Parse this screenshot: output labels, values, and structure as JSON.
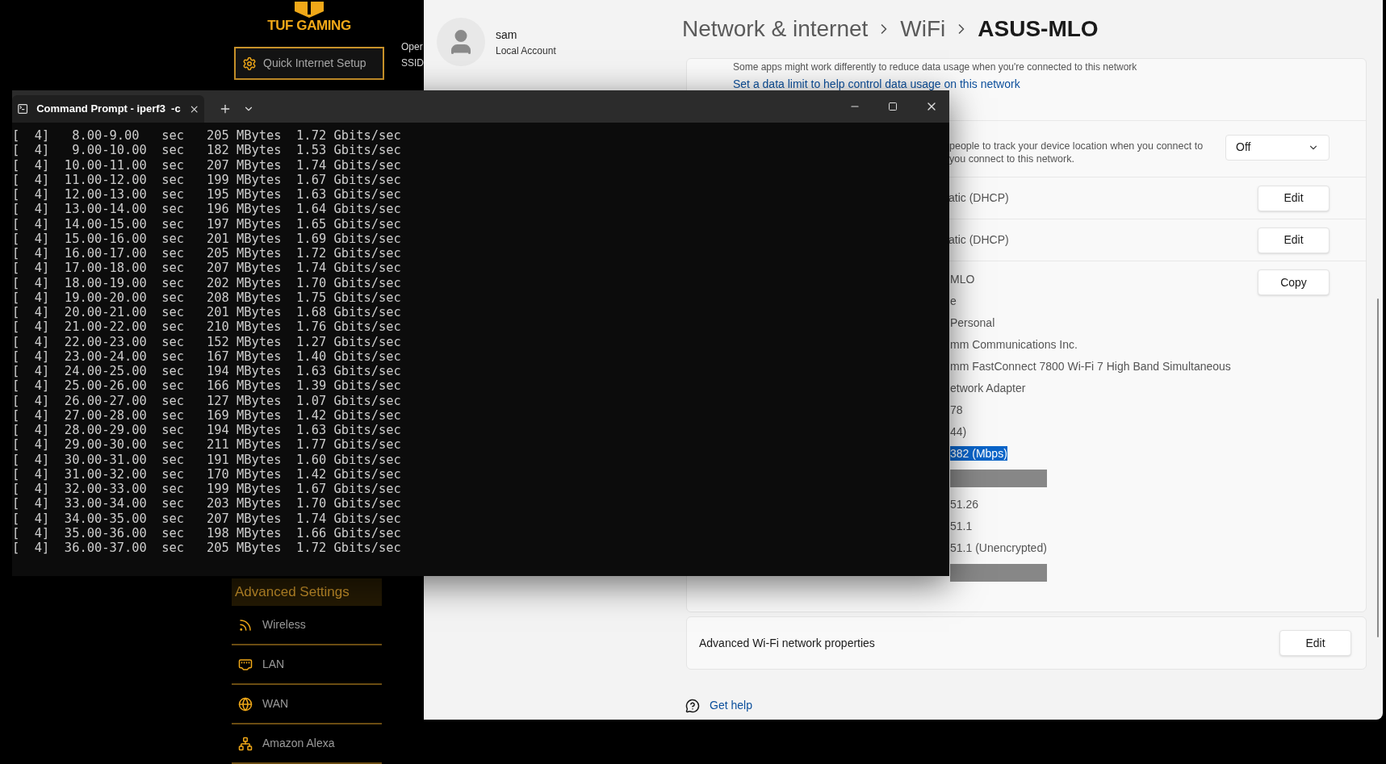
{
  "router": {
    "logo": "TUF GAMING",
    "quick_setup": "Quick Internet Setup",
    "status_labels": [
      "Oper",
      "SSID"
    ],
    "section_title": "Advanced Settings",
    "menu": [
      {
        "label": "Wireless",
        "kind": "wireless"
      },
      {
        "label": "LAN",
        "kind": "lan"
      },
      {
        "label": "WAN",
        "kind": "wan"
      },
      {
        "label": "Amazon Alexa",
        "kind": "alexa"
      }
    ]
  },
  "settings": {
    "user": {
      "name": "sam",
      "account_type": "Local Account"
    },
    "breadcrumb": [
      "Network & internet",
      "WiFi",
      "ASUS-MLO"
    ],
    "metered_note": "Some apps might work differently to reduce data usage when you're connected to this network",
    "data_limit_link": "Set a data limit to help control data usage on this network",
    "location": {
      "description": [
        "people to track your device location when you connect to",
        "you connect to this network."
      ],
      "dropdown": "Off"
    },
    "rows": [
      {
        "value": "atic (DHCP)",
        "button": "Edit"
      },
      {
        "value": "atic (DHCP)",
        "button": "Edit"
      }
    ],
    "properties": {
      "button": "Copy",
      "values": [
        {
          "kind": "text",
          "text": "MLO"
        },
        {
          "kind": "text",
          "text": "e"
        },
        {
          "kind": "text",
          "text": "Personal"
        },
        {
          "kind": "text",
          "text": "mm Communications Inc."
        },
        {
          "kind": "text",
          "text": "mm FastConnect 7800 Wi-Fi 7 High Band Simultaneous"
        },
        {
          "kind": "text",
          "text": "etwork Adapter"
        },
        {
          "kind": "text",
          "text": "78"
        },
        {
          "kind": "text",
          "text": "44)"
        },
        {
          "kind": "highlighted",
          "text": "382 (Mbps)"
        },
        {
          "kind": "redacted"
        },
        {
          "kind": "text",
          "text": "51.26"
        },
        {
          "kind": "text",
          "text": "51.1"
        },
        {
          "kind": "text",
          "text": "51.1 (Unencrypted)"
        },
        {
          "kind": "redacted"
        }
      ]
    },
    "advanced": {
      "label": "Advanced Wi-Fi network properties",
      "button": "Edit"
    },
    "help": "Get help"
  },
  "terminal": {
    "tab_title": "Command Prompt - iperf3  -c",
    "lines": [
      "[  4]   8.00-9.00   sec   205 MBytes  1.72 Gbits/sec",
      "[  4]   9.00-10.00  sec   182 MBytes  1.53 Gbits/sec",
      "[  4]  10.00-11.00  sec   207 MBytes  1.74 Gbits/sec",
      "[  4]  11.00-12.00  sec   199 MBytes  1.67 Gbits/sec",
      "[  4]  12.00-13.00  sec   195 MBytes  1.63 Gbits/sec",
      "[  4]  13.00-14.00  sec   196 MBytes  1.64 Gbits/sec",
      "[  4]  14.00-15.00  sec   197 MBytes  1.65 Gbits/sec",
      "[  4]  15.00-16.00  sec   201 MBytes  1.69 Gbits/sec",
      "[  4]  16.00-17.00  sec   205 MBytes  1.72 Gbits/sec",
      "[  4]  17.00-18.00  sec   207 MBytes  1.74 Gbits/sec",
      "[  4]  18.00-19.00  sec   202 MBytes  1.70 Gbits/sec",
      "[  4]  19.00-20.00  sec   208 MBytes  1.75 Gbits/sec",
      "[  4]  20.00-21.00  sec   201 MBytes  1.68 Gbits/sec",
      "[  4]  21.00-22.00  sec   210 MBytes  1.76 Gbits/sec",
      "[  4]  22.00-23.00  sec   152 MBytes  1.27 Gbits/sec",
      "[  4]  23.00-24.00  sec   167 MBytes  1.40 Gbits/sec",
      "[  4]  24.00-25.00  sec   194 MBytes  1.63 Gbits/sec",
      "[  4]  25.00-26.00  sec   166 MBytes  1.39 Gbits/sec",
      "[  4]  26.00-27.00  sec   127 MBytes  1.07 Gbits/sec",
      "[  4]  27.00-28.00  sec   169 MBytes  1.42 Gbits/sec",
      "[  4]  28.00-29.00  sec   194 MBytes  1.63 Gbits/sec",
      "[  4]  29.00-30.00  sec   211 MBytes  1.77 Gbits/sec",
      "[  4]  30.00-31.00  sec   191 MBytes  1.60 Gbits/sec",
      "[  4]  31.00-32.00  sec   170 MBytes  1.42 Gbits/sec",
      "[  4]  32.00-33.00  sec   199 MBytes  1.67 Gbits/sec",
      "[  4]  33.00-34.00  sec   203 MBytes  1.70 Gbits/sec",
      "[  4]  34.00-35.00  sec   207 MBytes  1.74 Gbits/sec",
      "[  4]  35.00-36.00  sec   198 MBytes  1.66 Gbits/sec",
      "[  4]  36.00-37.00  sec   205 MBytes  1.72 Gbits/sec"
    ]
  }
}
